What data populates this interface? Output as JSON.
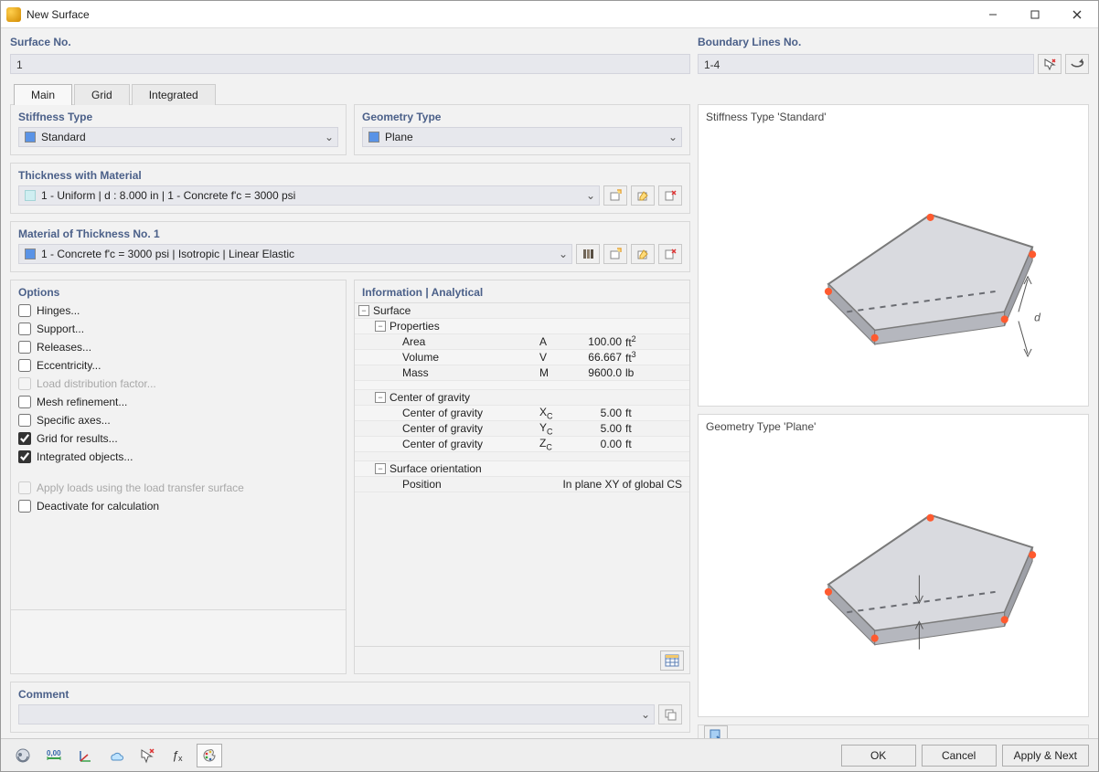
{
  "window": {
    "title": "New Surface"
  },
  "surface_no": {
    "label": "Surface No.",
    "value": "1"
  },
  "boundary": {
    "label": "Boundary Lines No.",
    "value": "1-4"
  },
  "tabs": {
    "main": "Main",
    "grid": "Grid",
    "integrated": "Integrated"
  },
  "stiffness": {
    "label": "Stiffness Type",
    "value": "Standard"
  },
  "geometry": {
    "label": "Geometry Type",
    "value": "Plane"
  },
  "thickness_mat": {
    "label": "Thickness with Material",
    "value": "1 - Uniform | d : 8.000 in | 1 - Concrete f'c = 3000 psi"
  },
  "material": {
    "label": "Material of Thickness No. 1",
    "value": "1 - Concrete f'c = 3000 psi | Isotropic | Linear Elastic"
  },
  "options": {
    "label": "Options",
    "hinges": "Hinges...",
    "support": "Support...",
    "releases": "Releases...",
    "eccentricity": "Eccentricity...",
    "load_dist": "Load distribution factor...",
    "mesh": "Mesh refinement...",
    "axes": "Specific axes...",
    "grid_results": "Grid for results...",
    "integrated": "Integrated objects...",
    "apply_loads": "Apply loads using the load transfer surface",
    "deactivate": "Deactivate for calculation"
  },
  "info": {
    "label": "Information | Analytical",
    "surface": "Surface",
    "properties": "Properties",
    "area": {
      "label": "Area",
      "sym": "A",
      "val": "100.00",
      "unit_html": "ft<sup>2</sup>"
    },
    "volume": {
      "label": "Volume",
      "sym": "V",
      "val": "66.667",
      "unit_html": "ft<sup>3</sup>"
    },
    "mass": {
      "label": "Mass",
      "sym": "M",
      "val": "9600.0",
      "unit": "lb"
    },
    "cog_header": "Center of gravity",
    "cog_x": {
      "label": "Center of gravity",
      "sym_html": "X<sub>C</sub>",
      "val": "5.00",
      "unit": "ft"
    },
    "cog_y": {
      "label": "Center of gravity",
      "sym_html": "Y<sub>C</sub>",
      "val": "5.00",
      "unit": "ft"
    },
    "cog_z": {
      "label": "Center of gravity",
      "sym_html": "Z<sub>C</sub>",
      "val": "0.00",
      "unit": "ft"
    },
    "orient_header": "Surface orientation",
    "position": {
      "label": "Position",
      "value": "In plane XY of global CS"
    }
  },
  "comment": {
    "label": "Comment",
    "value": ""
  },
  "preview": {
    "stiffness_title": "Stiffness Type 'Standard'",
    "geometry_title": "Geometry Type 'Plane'"
  },
  "buttons": {
    "ok": "OK",
    "cancel": "Cancel",
    "apply_next": "Apply & Next"
  }
}
